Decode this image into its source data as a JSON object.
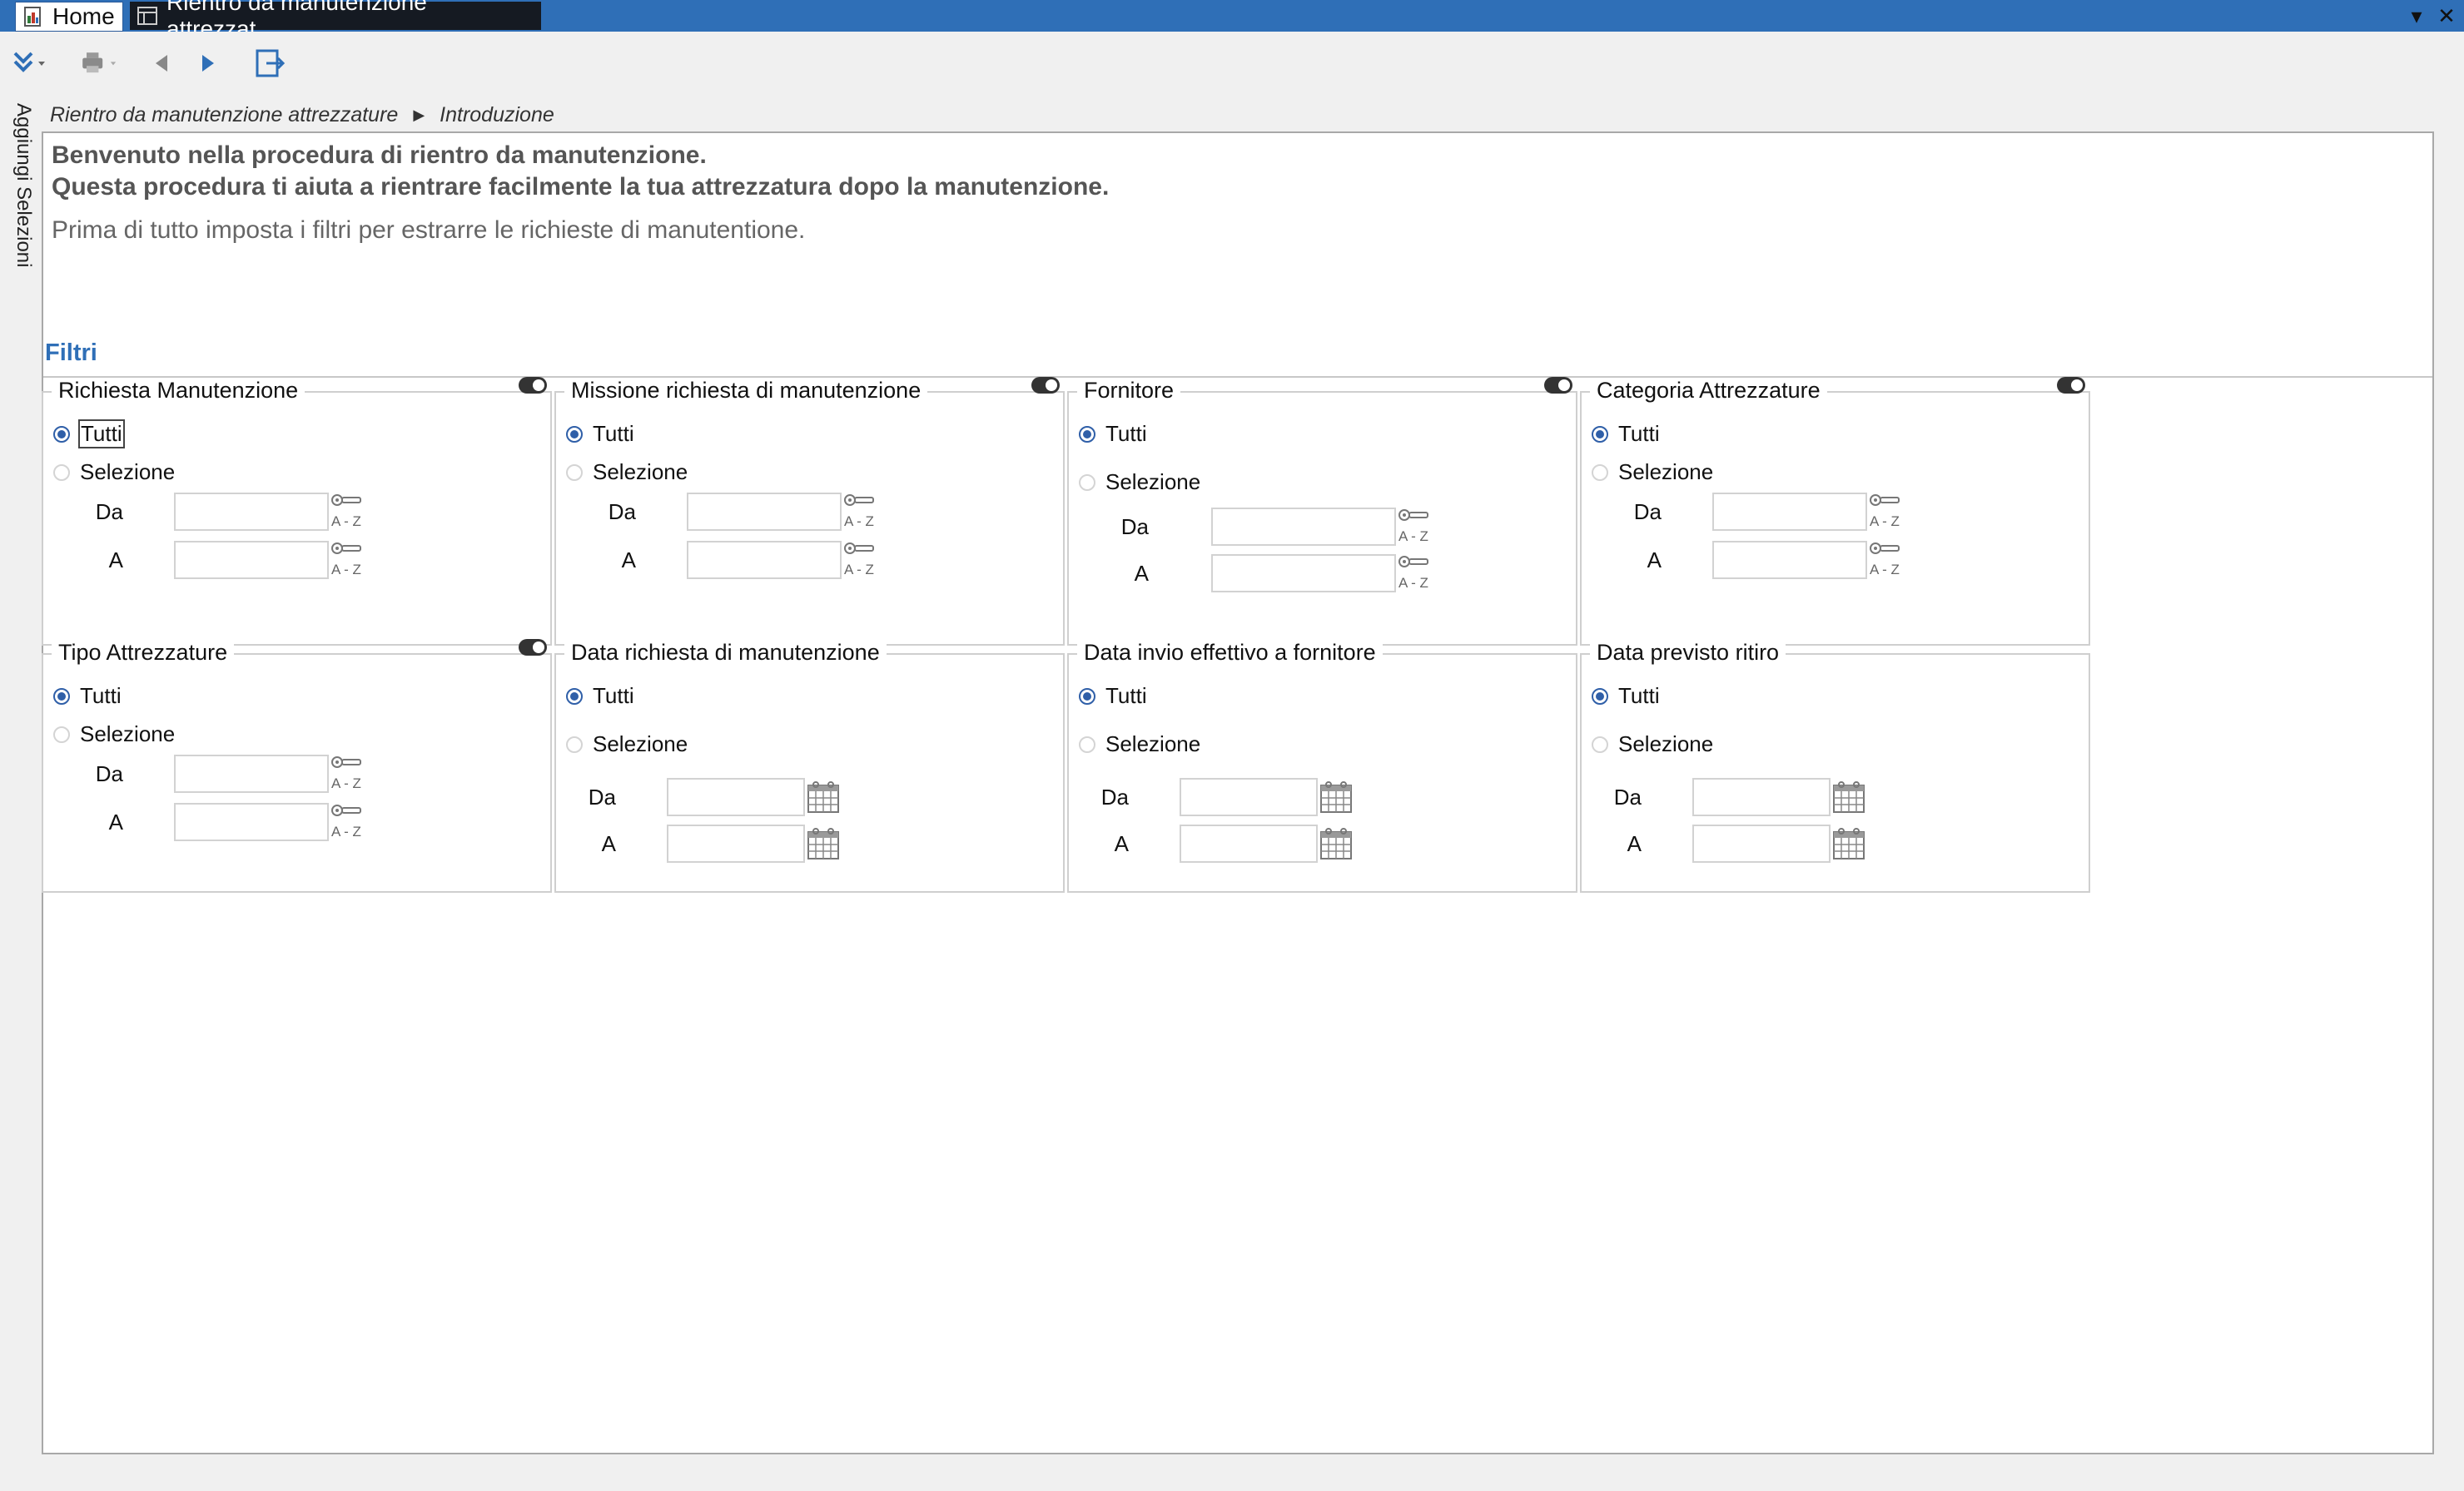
{
  "titlebar": {
    "tabs": [
      {
        "label": "Home"
      },
      {
        "label": "Rientro da manutenzione attrezzat..."
      }
    ],
    "controls": {
      "dropdown": "▾",
      "close": "✕"
    }
  },
  "toolbar": {
    "buttons": [
      "expand-icon",
      "print-icon",
      "back-icon",
      "forward-icon",
      "exit-icon"
    ]
  },
  "side": {
    "label": "Aggiungi Selezioni"
  },
  "breadcrumb": {
    "root": "Rientro da manutenzione attrezzature",
    "current": "Introduzione"
  },
  "intro": {
    "line1": "Benvenuto nella procedura di rientro da manutenzione.",
    "line2": "Questa procedura ti aiuta a rientrare facilmente la tua attrezzatura dopo la manutenzione.",
    "line3": "Prima di tutto imposta i filtri per estrarre le richieste di manutentione."
  },
  "filtri": {
    "title": "Filtri",
    "all_label": "Tutti",
    "select_label": "Selezione",
    "from_label": "Da",
    "to_label": "A",
    "boxes": [
      {
        "title": "Richiesta Manutenzione",
        "kind": "az",
        "selected": "Tutti"
      },
      {
        "title": "Missione richiesta di manutenzione",
        "kind": "az",
        "selected": "Tutti"
      },
      {
        "title": "Fornitore",
        "kind": "az",
        "selected": "Tutti"
      },
      {
        "title": "Categoria Attrezzature",
        "kind": "az",
        "selected": "Tutti"
      },
      {
        "title": "Tipo Attrezzature",
        "kind": "az",
        "selected": "Tutti"
      },
      {
        "title": "Data richiesta di manutenzione",
        "kind": "date",
        "selected": "Tutti"
      },
      {
        "title": "Data invio effettivo a fornitore",
        "kind": "date",
        "selected": "Tutti"
      },
      {
        "title": "Data previsto ritiro",
        "kind": "date",
        "selected": "Tutti"
      }
    ]
  },
  "colors": {
    "accent": "#2f6fb7",
    "radio": "#2f5fa8"
  }
}
